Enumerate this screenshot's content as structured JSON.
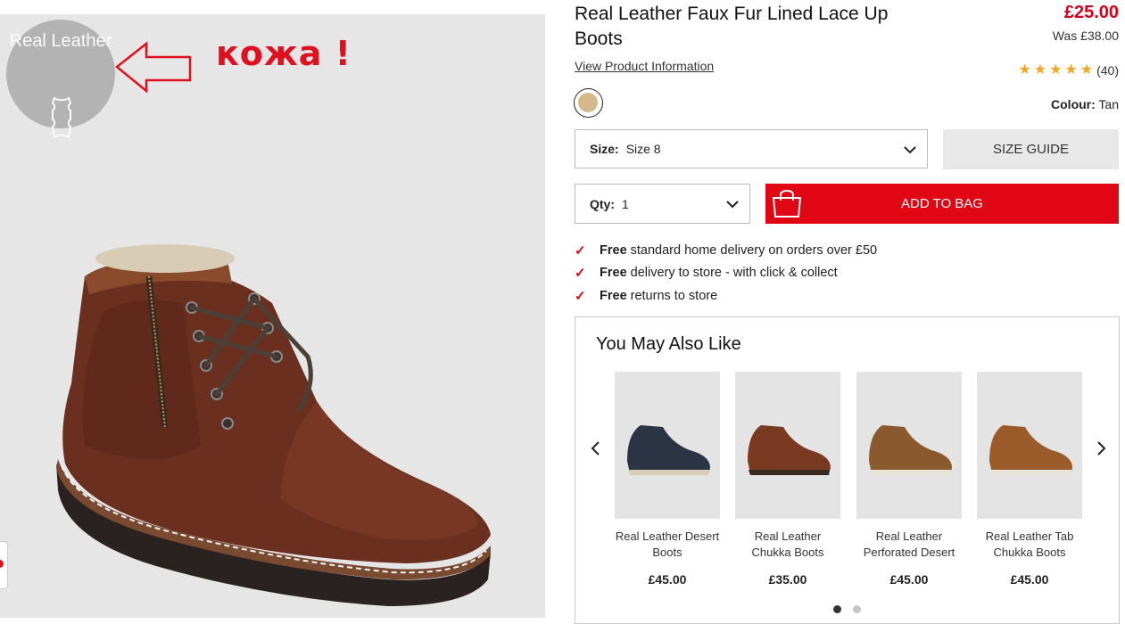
{
  "product": {
    "title": "Real Leather Faux Fur Lined Lace Up Boots",
    "price": "£25.00",
    "was_price": "Was £38.00",
    "view_info_link": "View Product Information",
    "rating_stars": 5,
    "review_count": "(40)",
    "colour_label": "Colour:",
    "colour_value": "Tan",
    "swatch_color": "#d6b98a"
  },
  "image": {
    "badge_text": "Real Leather",
    "annotation_text": "кожа !"
  },
  "size": {
    "label": "Size:",
    "value": "Size 8",
    "guide_label": "SIZE GUIDE"
  },
  "qty": {
    "label": "Qty:",
    "value": "1"
  },
  "add_to_bag_label": "ADD TO BAG",
  "benefits": [
    {
      "bold": "Free",
      "text": "standard home delivery on orders over £50"
    },
    {
      "bold": "Free",
      "text": "delivery to store - with click & collect"
    },
    {
      "bold": "Free",
      "text": "returns to store"
    }
  ],
  "recommendations": {
    "title": "You May Also Like",
    "items": [
      {
        "name": "Real Leather Desert Boots",
        "price": "£45.00",
        "shoe_color": "#2b3445"
      },
      {
        "name": "Real Leather Chukka Boots",
        "price": "£35.00",
        "shoe_color": "#7a3a22"
      },
      {
        "name": "Real Leather Perforated Desert",
        "price": "£45.00",
        "shoe_color": "#8a5a2e"
      },
      {
        "name": "Real Leather Tab Chukka Boots",
        "price": "£45.00",
        "shoe_color": "#9a5a2a"
      }
    ],
    "pages": 2,
    "active_page": 1
  },
  "colors": {
    "accent_red": "#e10613",
    "price_red": "#d7001e",
    "star": "#f5a623"
  }
}
